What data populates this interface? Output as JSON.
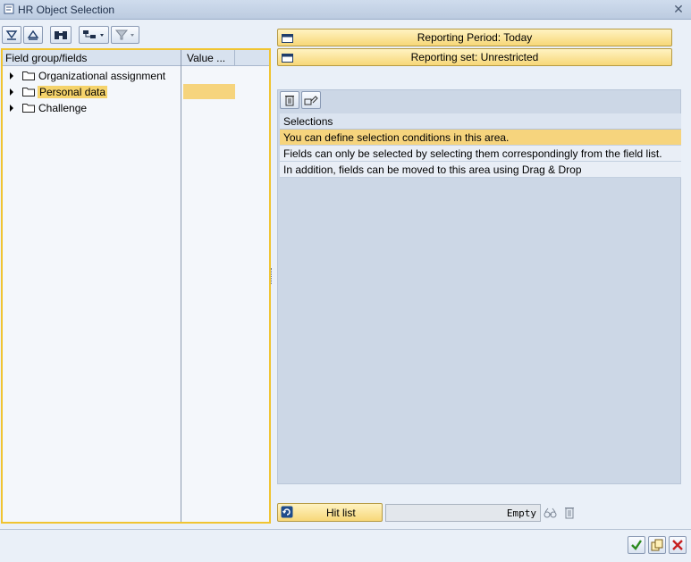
{
  "window": {
    "title": "HR Object Selection"
  },
  "left_toolbar": {
    "buttons": [
      "expand-all",
      "collapse-all",
      "find",
      "layout-dropdown",
      "filter-dropdown"
    ]
  },
  "tree": {
    "headers": {
      "field_group": "Field group/fields",
      "value": "Value ..."
    },
    "items": [
      {
        "label": "Organizational assignment"
      },
      {
        "label": "Personal data"
      },
      {
        "label": "Challenge"
      }
    ]
  },
  "reporting": {
    "period": "Reporting Period: Today",
    "set": "Reporting set: Unrestricted"
  },
  "selections": {
    "header": "Selections",
    "rows": [
      "You can define selection conditions in this area.",
      "Fields can only be selected by selecting them correspondingly from the field list.",
      "In addition, fields can be moved to this area using Drag & Drop"
    ]
  },
  "hitlist": {
    "button": "Hit list",
    "value": "Empty"
  },
  "colors": {
    "accent": "#f0c431",
    "highlight": "#f6d47d",
    "panel": "#ccd7e6"
  }
}
